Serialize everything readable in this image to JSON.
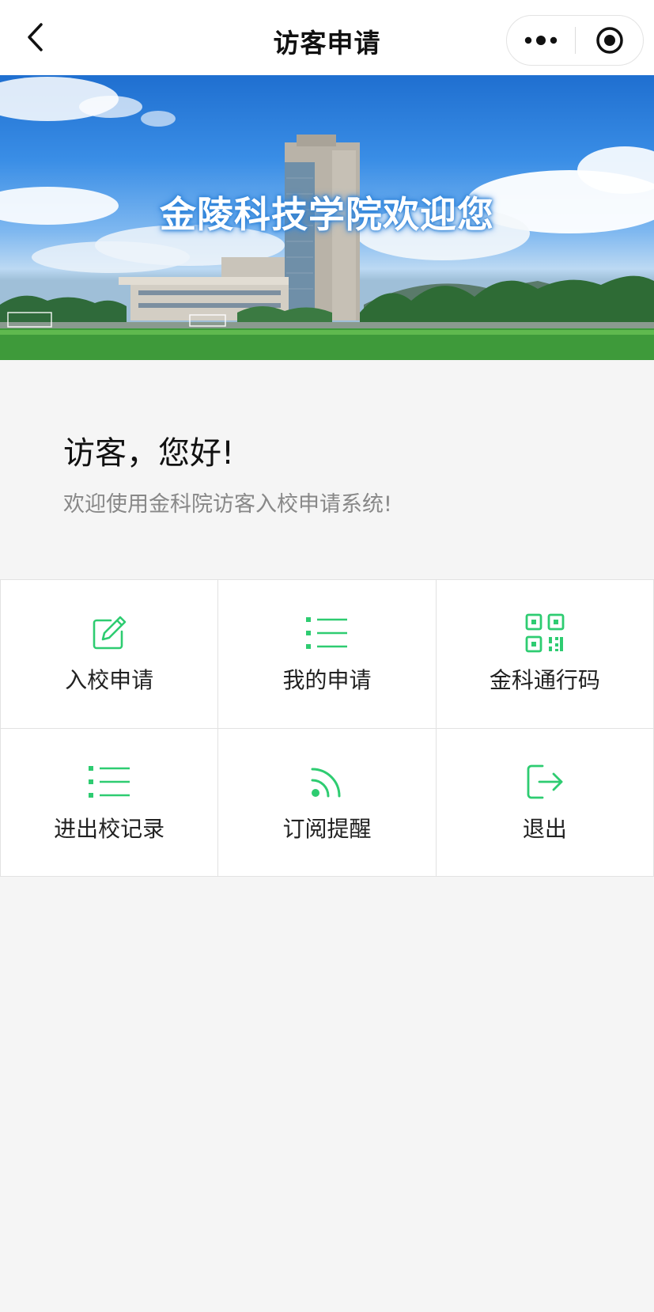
{
  "navbar": {
    "title": "访客申请",
    "back_icon": "chevron-left-icon",
    "more_icon": "more-dots-icon",
    "close_icon": "record-circle-icon"
  },
  "banner": {
    "text": "金陵科技学院欢迎您"
  },
  "greeting": {
    "title": "访客，您好!",
    "subtitle": "欢迎使用金科院访客入校申请系统!"
  },
  "grid": {
    "items": [
      {
        "label": "入校申请",
        "icon": "edit-icon"
      },
      {
        "label": "我的申请",
        "icon": "list-icon"
      },
      {
        "label": "金科通行码",
        "icon": "qr-code-icon"
      },
      {
        "label": "进出校记录",
        "icon": "list-icon"
      },
      {
        "label": "订阅提醒",
        "icon": "rss-icon"
      },
      {
        "label": "退出",
        "icon": "logout-icon"
      }
    ]
  },
  "colors": {
    "accent": "#2ecc71",
    "text": "#222222",
    "subtext": "#888888",
    "background": "#f5f5f5"
  }
}
